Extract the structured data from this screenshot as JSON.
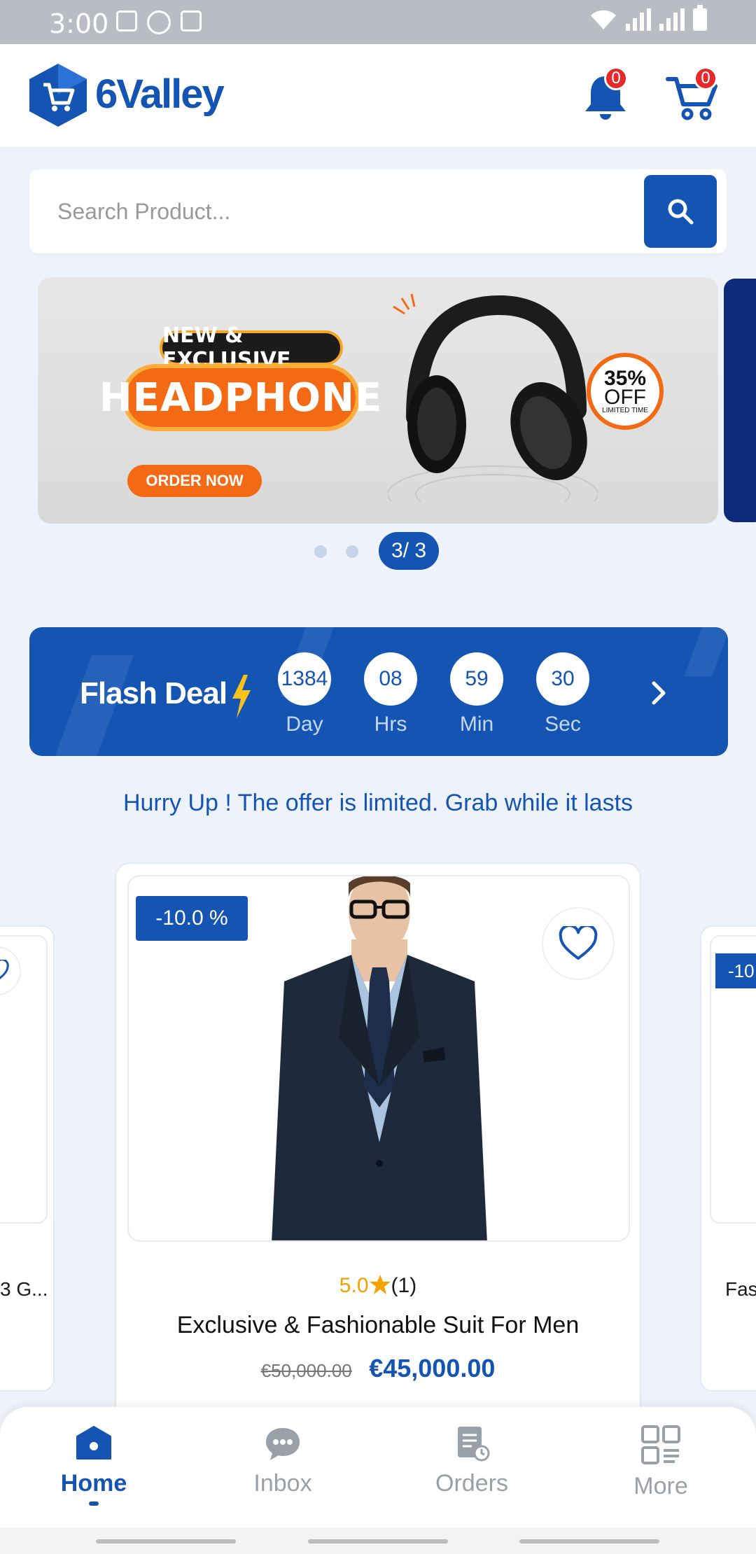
{
  "status_bar": {
    "time": "3:00"
  },
  "header": {
    "brand": "6Valley",
    "notification_count": "0",
    "cart_count": "0"
  },
  "search": {
    "placeholder": "Search Product..."
  },
  "banner": {
    "tag": "NEW & EXCLUSIVE",
    "title": "HEADPHONE",
    "cta": "ORDER NOW",
    "discount_pct": "35%",
    "discount_off": "OFF",
    "discount_note": "LIMITED TIME",
    "page_indicator": "3/ 3"
  },
  "flash_deal": {
    "title": "Flash Deal",
    "timer": [
      {
        "value": "1384",
        "label": "Day"
      },
      {
        "value": "08",
        "label": "Hrs"
      },
      {
        "value": "59",
        "label": "Min"
      },
      {
        "value": "30",
        "label": "Sec"
      }
    ],
    "subtitle": "Hurry Up ! The offer is limited. Grab while it lasts"
  },
  "products": {
    "main": {
      "discount": "-10.0 %",
      "rating": "5.0",
      "reviews": "(1)",
      "name": "Exclusive & Fashionable Suit For Men",
      "old_price": "€50,000.00",
      "price": "€45,000.00"
    },
    "left_peek": {
      "name": "3 G..."
    },
    "right_peek": {
      "discount": "-10",
      "name": "Fas"
    }
  },
  "bottom_nav": [
    {
      "label": "Home",
      "icon": "home-icon"
    },
    {
      "label": "Inbox",
      "icon": "chat-icon"
    },
    {
      "label": "Orders",
      "icon": "orders-icon"
    },
    {
      "label": "More",
      "icon": "grid-icon"
    }
  ],
  "colors": {
    "primary": "#1455b3",
    "accent": "#f46a14",
    "badge": "#e32b2b",
    "star": "#f5a100"
  }
}
